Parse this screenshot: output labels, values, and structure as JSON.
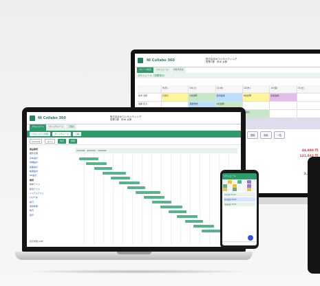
{
  "brand": {
    "logo_text": "NI Collabo 360",
    "accent": "#2f9a6a",
    "accent_dark": "#2c7f5f"
  },
  "monitor": {
    "company_line1": "株式会社NIコンサルティング",
    "company_line2": "営業1課　鈴木 太郎",
    "tabs": [
      "グループ表示",
      "スケジュール",
      "行動予定表"
    ],
    "sub_title": "スケジュール（週間表示）",
    "calendar_header": [
      "",
      "9(月)",
      "10(火)",
      "11(水)",
      "12(木)",
      "13(金)",
      "14(土)"
    ],
    "calendar_rows": [
      [
        "鈴木 太郎",
        "打合せ",
        "A社訪問",
        "社内会議",
        "B社訪問",
        "企画会議",
        ""
      ],
      [
        "佐藤 花子",
        "",
        "見積作成",
        "C社訪問",
        "",
        "",
        ""
      ],
      [
        "田中 次郎",
        "研修",
        "",
        "D社訪問",
        "打合せ",
        "",
        ""
      ]
    ],
    "buttons": [
      "登録",
      "削除",
      "一覧"
    ],
    "amounts": [
      "44,000 円",
      "121,032 円",
      "2,632 円"
    ]
  },
  "laptop": {
    "company_line1": "株式会社NIコンサルティング",
    "company_line2": "営業1課　鈴木 太郎",
    "tabs": [
      "プロジェクト",
      "ガントチャート",
      "工程表"
    ],
    "toolbar": [
      "プロジェクト管理",
      "ガントチャート",
      "工程"
    ],
    "filter_fields": [
      "2023/04",
      "すべて"
    ],
    "filter_buttons": [
      "表示",
      "検索"
    ],
    "tree": [
      "製品開発",
      "要件定義",
      "基本設計",
      "詳細設計",
      "画面設計",
      "帳票設計",
      "DB設計",
      "開発",
      "単体テスト",
      "結合テスト",
      "システムテスト",
      "リリース",
      "移行",
      "運用準備",
      "教育",
      "保守"
    ],
    "gantt_header": "2023/04　2023/05　2023/06",
    "footer_text": "表示件数 16件"
  },
  "phone": {
    "title": "スケジュール",
    "list": [
      "A社訪問 10:00",
      "社内会議 13:00",
      "企画会議 16:00"
    ]
  }
}
